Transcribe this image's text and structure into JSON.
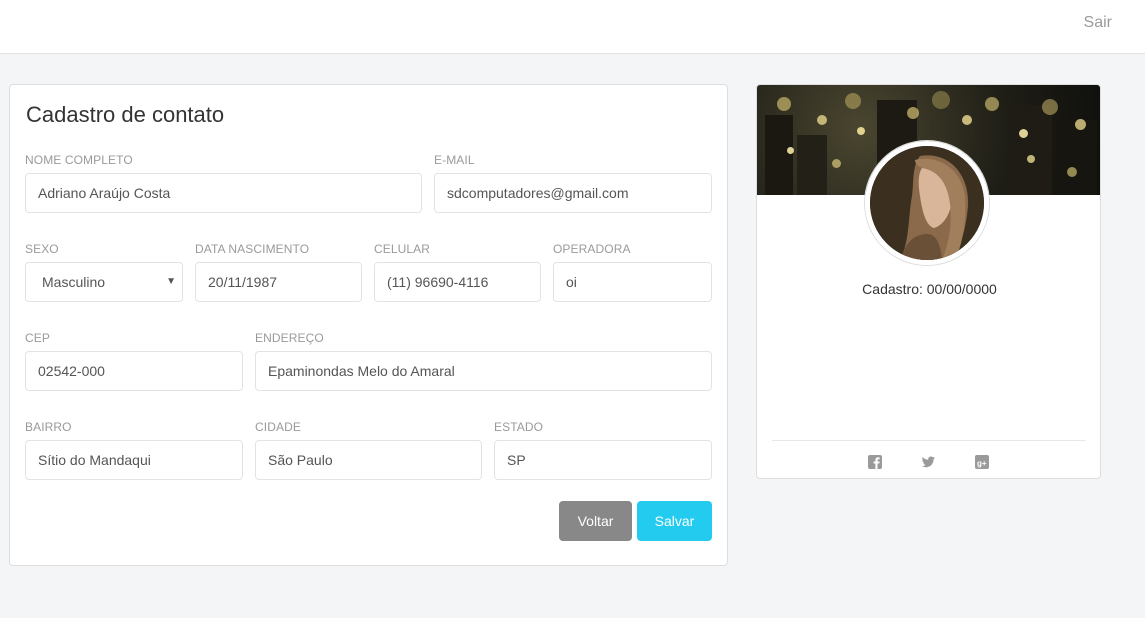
{
  "header": {
    "logout_label": "Sair"
  },
  "form": {
    "title": "Cadastro de contato",
    "fields": {
      "full_name": {
        "label": "NOME COMPLETO",
        "value": "Adriano Araújo Costa"
      },
      "email": {
        "label": "E-MAIL",
        "value": "sdcomputadores@gmail.com"
      },
      "sex": {
        "label": "SEXO",
        "value": "Masculino"
      },
      "birth_date": {
        "label": "DATA NASCIMENTO",
        "value": "20/11/1987"
      },
      "mobile": {
        "label": "CELULAR",
        "value": "(11) 96690-4116"
      },
      "carrier": {
        "label": "OPERADORA",
        "value": "oi"
      },
      "zip": {
        "label": "CEP",
        "value": "02542-000"
      },
      "address": {
        "label": "ENDEREÇO",
        "value": "Epaminondas Melo do Amaral"
      },
      "district": {
        "label": "BAIRRO",
        "value": "Sítio do Mandaqui"
      },
      "city": {
        "label": "CIDADE",
        "value": "São Paulo"
      },
      "state": {
        "label": "ESTADO",
        "value": "SP"
      }
    },
    "buttons": {
      "back": "Voltar",
      "save": "Salvar"
    }
  },
  "profile": {
    "registration_text": "Cadastro: 00/00/0000",
    "social": [
      "facebook-icon",
      "twitter-icon",
      "google-plus-icon"
    ]
  },
  "colors": {
    "save_button": "#23ccef",
    "back_button": "#888888"
  }
}
